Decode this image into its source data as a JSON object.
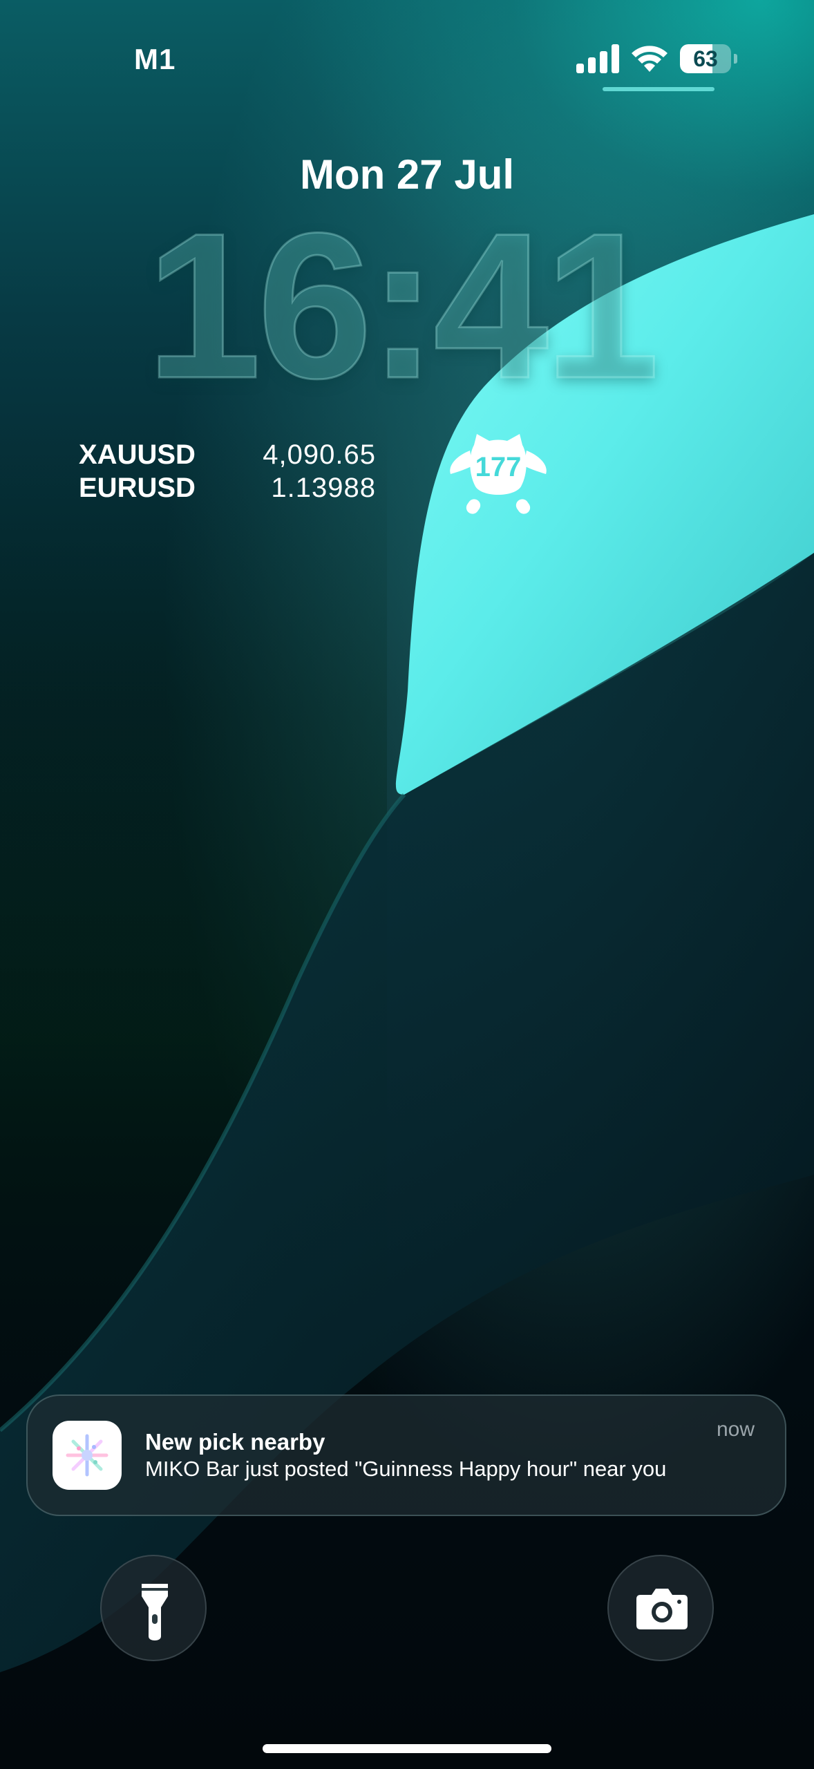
{
  "status_bar": {
    "carrier": "M1",
    "battery_level": "63",
    "battery_fraction": 0.63
  },
  "lock_screen": {
    "date": "Mon 27 Jul",
    "time": "16:41"
  },
  "widgets": {
    "tickers": [
      {
        "symbol": "XAUUSD",
        "price": "4,090.65"
      },
      {
        "symbol": "EURUSD",
        "price": "1.13988"
      }
    ],
    "streak": {
      "count": "177"
    }
  },
  "notification": {
    "title": "New pick nearby",
    "time": "now",
    "body": "MIKO Bar just posted \"Guinness Happy hour\" near you"
  },
  "quick_actions": {
    "left": "flashlight-icon",
    "right": "camera-icon"
  },
  "colors": {
    "accent_teal": "#45d9d9",
    "wallpaper_highlight": "#6ef7f2"
  }
}
